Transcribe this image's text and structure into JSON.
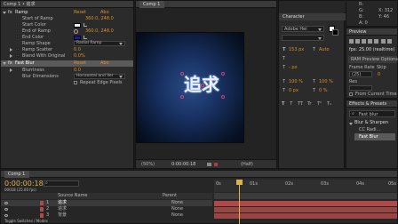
{
  "effect_controls": {
    "header": "Comp 1 • 追求",
    "ramp": {
      "fx_badge": "fx",
      "title": "Ramp",
      "reset": "Reset",
      "about": "Abo",
      "params": [
        {
          "label": "Start of Ramp",
          "value": "360.0, 248.0"
        },
        {
          "label": "Start Color",
          "value": ""
        },
        {
          "label": "End of Ramp",
          "value": "360.0, 248.0"
        },
        {
          "label": "End Color",
          "value": ""
        },
        {
          "label": "Ramp Shape",
          "value": "Radial Ramp"
        },
        {
          "label": "Ramp Scatter",
          "value": "0.0"
        },
        {
          "label": "Blend With Original",
          "value": "0.0%"
        }
      ],
      "start_color": "#f0f0f0",
      "end_color": "#1a1aa8"
    },
    "fast_blur": {
      "fx_badge": "fx",
      "title": "Fast Blur",
      "reset": "Reset",
      "about": "Abo",
      "params": [
        {
          "label": "Blurriness",
          "value": "0.0"
        },
        {
          "label": "Blur Dimensions",
          "value": "Horizontal and Ver"
        }
      ],
      "repeat_edge": "Repeat Edge Pixels"
    }
  },
  "composition": {
    "tab": "Comp 1",
    "title_text": "追求",
    "zoom": "(50%)",
    "timecode": "0:00:00:18",
    "resolution": "(Half)"
  },
  "character": {
    "tab": "Character",
    "font": "Adobe Hei",
    "weight_glyph": "T",
    "size": "153 px",
    "tracking": "",
    "leading": "Auto",
    "stroke_width": "- px",
    "vscale": "100 %",
    "hscale": "100 %",
    "baseline": "0 px",
    "tsume": "0 %",
    "style_buttons": [
      "T",
      "T",
      "TT",
      "Tr",
      "T¹",
      "T₁"
    ]
  },
  "info": {
    "r": "R:",
    "g": "G:",
    "b": "B:",
    "a": "A: 0",
    "x": "X: 312",
    "y": "Y: 46"
  },
  "preview": {
    "tab": "Preview",
    "fps": "fps: 25.00 (realtime)",
    "ram_options": "RAM Preview Options",
    "frame_rate_label": "Frame Rate",
    "skip_label": "Skip",
    "frame_rate_value": "(25)",
    "skip_value": "0",
    "from_current": "From Current Time",
    "resolution_label": "Res"
  },
  "effects_presets": {
    "tab": "Effects & Presets",
    "search_value": "Fast blur",
    "category": "Blur & Sharpen",
    "items": [
      "CC Radi...",
      "Fast Blur"
    ]
  },
  "timeline": {
    "tab": "Comp 1",
    "timecode": "0:00:00:18",
    "frames": "00018 (25.00 fps)",
    "columns": {
      "source": "Source Name",
      "parent": "Parent"
    },
    "layers": [
      {
        "num": "1",
        "name": "追求",
        "parent": "None",
        "color": "#b04a4a"
      },
      {
        "num": "2",
        "name": "追求",
        "parent": "None",
        "color": "#b04a4a"
      },
      {
        "num": "3",
        "name": "背景",
        "parent": "None",
        "color": "#b04a4a"
      }
    ],
    "ruler_labels": [
      "0s",
      "01s",
      "02s",
      "03s",
      "04s",
      "05s"
    ],
    "toggle_label": "Toggle Switches / Modes"
  }
}
